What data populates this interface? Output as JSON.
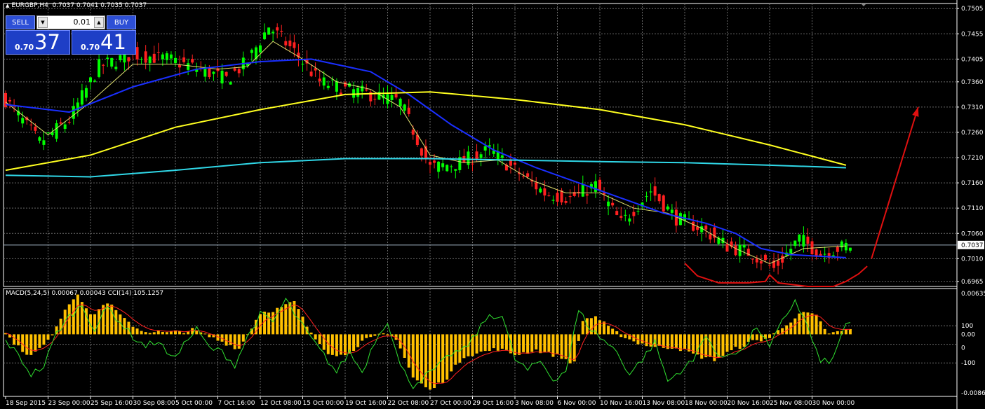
{
  "header": {
    "symbol": "EURGBP,H4",
    "ohlc": "0.7037 0.7041 0.7035 0.7037"
  },
  "trade_panel": {
    "sell_label": "SELL",
    "buy_label": "BUY",
    "lot": "0.01",
    "sell_prefix": "0.70",
    "sell_big": "37",
    "buy_prefix": "0.70",
    "buy_big": "41"
  },
  "indicator_header": "MACD(5,24,5) 0.00067 0.00043  CCI(14) 105.1257",
  "colors": {
    "bull": "#00ff00",
    "bear": "#ff2020",
    "ma_fast": "#e0e070",
    "ma_mid": "#1a2fff",
    "ma_slow": "#ffff20",
    "ma_cyan": "#30d8e8",
    "hist": "#ffc000",
    "signal": "#ff2020",
    "cci": "#30e030",
    "arrow": "#e01010",
    "grid": "#6a6a6a"
  },
  "chart_data": {
    "type": "candlestick",
    "symbol": "EURGBP",
    "timeframe": "H4",
    "grid": true,
    "current_price": "0.7037",
    "price_axis": {
      "ticks": [
        "0.7505",
        "0.7455",
        "0.7405",
        "0.7360",
        "0.7310",
        "0.7260",
        "0.7210",
        "0.7160",
        "0.7110",
        "0.7060",
        "0.7010",
        "0.6965"
      ],
      "range": [
        0.6955,
        0.7515
      ]
    },
    "time_labels": [
      "18 Sep 2015",
      "23 Sep 00:00",
      "25 Sep 16:00",
      "30 Sep 08:00",
      "5 Oct 00:00",
      "7 Oct 16:00",
      "12 Oct 08:00",
      "15 Oct 00:00",
      "19 Oct 16:00",
      "22 Oct 08:00",
      "27 Oct 00:00",
      "29 Oct 16:00",
      "3 Nov 08:00",
      "6 Nov 00:00",
      "10 Nov 16:00",
      "13 Nov 08:00",
      "18 Nov 00:00",
      "20 Nov 16:00",
      "25 Nov 08:00",
      "30 Nov 00:00"
    ],
    "close_path": [
      [
        0,
        0.7325
      ],
      [
        8,
        0.724
      ],
      [
        15,
        0.7285
      ],
      [
        22,
        0.739
      ],
      [
        30,
        0.7415
      ],
      [
        38,
        0.7405
      ],
      [
        46,
        0.7385
      ],
      [
        52,
        0.7365
      ],
      [
        57,
        0.74
      ],
      [
        62,
        0.747
      ],
      [
        68,
        0.742
      ],
      [
        74,
        0.736
      ],
      [
        80,
        0.7345
      ],
      [
        86,
        0.7335
      ],
      [
        93,
        0.732
      ],
      [
        100,
        0.719
      ],
      [
        107,
        0.72
      ],
      [
        114,
        0.7225
      ],
      [
        120,
        0.7185
      ],
      [
        127,
        0.714
      ],
      [
        133,
        0.713
      ],
      [
        139,
        0.7155
      ],
      [
        145,
        0.708
      ],
      [
        152,
        0.7145
      ],
      [
        158,
        0.709
      ],
      [
        164,
        0.707
      ],
      [
        170,
        0.7035
      ],
      [
        176,
        0.702
      ],
      [
        181,
        0.699
      ],
      [
        187,
        0.705
      ],
      [
        192,
        0.702
      ],
      [
        198,
        0.7035
      ]
    ],
    "moving_averages": [
      {
        "color": "ma_fast",
        "path": [
          [
            0,
            0.732
          ],
          [
            10,
            0.7255
          ],
          [
            20,
            0.732
          ],
          [
            30,
            0.7395
          ],
          [
            40,
            0.7395
          ],
          [
            50,
            0.7385
          ],
          [
            57,
            0.739
          ],
          [
            63,
            0.744
          ],
          [
            70,
            0.7405
          ],
          [
            78,
            0.736
          ],
          [
            86,
            0.7345
          ],
          [
            93,
            0.731
          ],
          [
            100,
            0.7215
          ],
          [
            108,
            0.72
          ],
          [
            116,
            0.7205
          ],
          [
            124,
            0.7165
          ],
          [
            132,
            0.714
          ],
          [
            140,
            0.714
          ],
          [
            148,
            0.711
          ],
          [
            156,
            0.71
          ],
          [
            164,
            0.707
          ],
          [
            172,
            0.703
          ],
          [
            180,
            0.7
          ],
          [
            188,
            0.703
          ],
          [
            198,
            0.7035
          ]
        ]
      },
      {
        "color": "ma_mid",
        "path": [
          [
            0,
            0.7315
          ],
          [
            15,
            0.73
          ],
          [
            30,
            0.735
          ],
          [
            45,
            0.7385
          ],
          [
            60,
            0.74
          ],
          [
            72,
            0.7405
          ],
          [
            86,
            0.738
          ],
          [
            95,
            0.7335
          ],
          [
            105,
            0.7275
          ],
          [
            115,
            0.7225
          ],
          [
            125,
            0.719
          ],
          [
            135,
            0.716
          ],
          [
            145,
            0.713
          ],
          [
            155,
            0.71
          ],
          [
            165,
            0.708
          ],
          [
            172,
            0.706
          ],
          [
            178,
            0.703
          ],
          [
            185,
            0.7018
          ],
          [
            198,
            0.7012
          ]
        ]
      },
      {
        "color": "ma_slow",
        "path": [
          [
            0,
            0.7185
          ],
          [
            20,
            0.7215
          ],
          [
            40,
            0.727
          ],
          [
            60,
            0.7305
          ],
          [
            80,
            0.7335
          ],
          [
            100,
            0.734
          ],
          [
            120,
            0.7325
          ],
          [
            140,
            0.7305
          ],
          [
            160,
            0.7275
          ],
          [
            180,
            0.7235
          ],
          [
            198,
            0.7195
          ]
        ]
      },
      {
        "color": "ma_cyan",
        "path": [
          [
            0,
            0.7175
          ],
          [
            20,
            0.7172
          ],
          [
            40,
            0.7185
          ],
          [
            60,
            0.72
          ],
          [
            80,
            0.7208
          ],
          [
            100,
            0.7208
          ],
          [
            120,
            0.7205
          ],
          [
            140,
            0.7202
          ],
          [
            160,
            0.72
          ],
          [
            180,
            0.7195
          ],
          [
            198,
            0.719
          ]
        ]
      }
    ],
    "pattern_arc": {
      "color": "arrow",
      "path": [
        [
          160,
          0.7001
        ],
        [
          163,
          0.6976
        ],
        [
          168,
          0.6962
        ],
        [
          175,
          0.6962
        ],
        [
          179,
          0.6965
        ],
        [
          180,
          0.6978
        ],
        [
          182,
          0.6962
        ],
        [
          189,
          0.6955
        ],
        [
          195,
          0.6955
        ],
        [
          198,
          0.6965
        ],
        [
          201,
          0.698
        ],
        [
          203,
          0.6995
        ]
      ]
    },
    "forecast_arrow": {
      "color": "arrow",
      "from": [
        204,
        0.701
      ],
      "to": [
        215,
        0.731
      ]
    },
    "sub_window": {
      "macd_axis_ticks": [
        "0.00635",
        "0.00",
        "-0.00861"
      ],
      "cci_axis_ticks": [
        "100",
        "0",
        "-100"
      ],
      "macd_range": [
        -0.00861,
        0.00635
      ],
      "cci_range": [
        -280,
        300
      ],
      "histogram_path": [
        [
          0,
          0.0001
        ],
        [
          3,
          -0.0018
        ],
        [
          6,
          -0.003
        ],
        [
          10,
          -0.001
        ],
        [
          14,
          0.0035
        ],
        [
          17,
          0.0058
        ],
        [
          20,
          0.0025
        ],
        [
          24,
          0.0045
        ],
        [
          28,
          0.002
        ],
        [
          32,
          0.0005
        ],
        [
          38,
          0.0002
        ],
        [
          44,
          0.0006
        ],
        [
          50,
          -0.0008
        ],
        [
          55,
          -0.002
        ],
        [
          60,
          0.003
        ],
        [
          64,
          0.0035
        ],
        [
          68,
          0.0045
        ],
        [
          72,
          0.0
        ],
        [
          76,
          -0.0025
        ],
        [
          80,
          -0.003
        ],
        [
          84,
          -0.001
        ],
        [
          89,
          0.0
        ],
        [
          92,
          -0.0005
        ],
        [
          96,
          -0.006
        ],
        [
          100,
          -0.0078
        ],
        [
          104,
          -0.006
        ],
        [
          108,
          -0.003
        ],
        [
          112,
          -0.0025
        ],
        [
          116,
          -0.002
        ],
        [
          120,
          -0.0028
        ],
        [
          125,
          -0.0022
        ],
        [
          130,
          -0.003
        ],
        [
          134,
          -0.004
        ],
        [
          136,
          0.002
        ],
        [
          139,
          0.0025
        ],
        [
          143,
          0.0005
        ],
        [
          148,
          -0.001
        ],
        [
          153,
          -0.0018
        ],
        [
          158,
          -0.0018
        ],
        [
          163,
          -0.003
        ],
        [
          167,
          -0.0035
        ],
        [
          172,
          -0.002
        ],
        [
          176,
          -0.001
        ],
        [
          180,
          -0.0005
        ],
        [
          184,
          0.0015
        ],
        [
          188,
          0.003
        ],
        [
          191,
          0.0025
        ],
        [
          194,
          0.0
        ],
        [
          198,
          0.0006
        ]
      ],
      "cci_path": [
        [
          0,
          20
        ],
        [
          3,
          -60
        ],
        [
          6,
          -160
        ],
        [
          9,
          -120
        ],
        [
          12,
          60
        ],
        [
          15,
          150
        ],
        [
          18,
          210
        ],
        [
          21,
          80
        ],
        [
          24,
          200
        ],
        [
          27,
          120
        ],
        [
          30,
          40
        ],
        [
          33,
          -10
        ],
        [
          36,
          20
        ],
        [
          39,
          -80
        ],
        [
          42,
          0
        ],
        [
          45,
          80
        ],
        [
          48,
          -20
        ],
        [
          51,
          -40
        ],
        [
          54,
          -110
        ],
        [
          57,
          40
        ],
        [
          60,
          160
        ],
        [
          63,
          120
        ],
        [
          66,
          240
        ],
        [
          69,
          130
        ],
        [
          72,
          30
        ],
        [
          75,
          -60
        ],
        [
          78,
          -150
        ],
        [
          81,
          -40
        ],
        [
          84,
          -150
        ],
        [
          87,
          20
        ],
        [
          90,
          130
        ],
        [
          93,
          -120
        ],
        [
          96,
          -220
        ],
        [
          99,
          -170
        ],
        [
          102,
          -120
        ],
        [
          105,
          -50
        ],
        [
          108,
          -30
        ],
        [
          111,
          60
        ],
        [
          114,
          160
        ],
        [
          117,
          150
        ],
        [
          120,
          -80
        ],
        [
          123,
          -140
        ],
        [
          126,
          -90
        ],
        [
          129,
          -190
        ],
        [
          132,
          -140
        ],
        [
          135,
          180
        ],
        [
          138,
          80
        ],
        [
          141,
          20
        ],
        [
          144,
          -40
        ],
        [
          147,
          -160
        ],
        [
          150,
          -80
        ],
        [
          153,
          10
        ],
        [
          156,
          -200
        ],
        [
          159,
          -140
        ],
        [
          162,
          -90
        ],
        [
          165,
          60
        ],
        [
          168,
          -80
        ],
        [
          171,
          -40
        ],
        [
          174,
          -30
        ],
        [
          177,
          100
        ],
        [
          180,
          -20
        ],
        [
          183,
          120
        ],
        [
          186,
          240
        ],
        [
          189,
          90
        ],
        [
          192,
          -100
        ],
        [
          195,
          -80
        ],
        [
          198,
          120
        ]
      ]
    }
  }
}
